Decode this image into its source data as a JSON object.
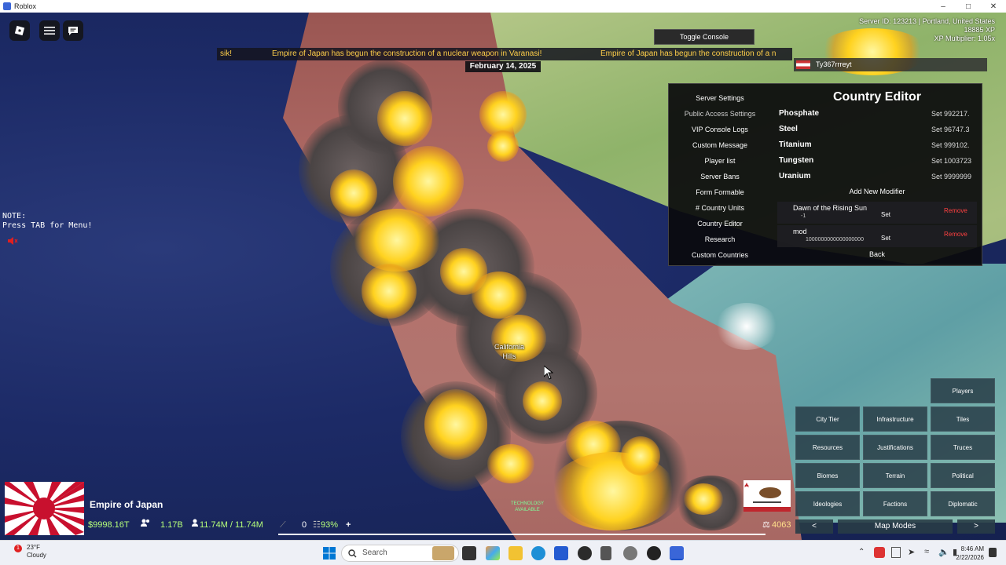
{
  "window": {
    "title": "Roblox"
  },
  "hud": {
    "note_line1": "NOTE:",
    "note_line2": "Press TAB for Menu!",
    "toggle_console": "Toggle Console",
    "date": "February 14, 2025",
    "ticker": [
      "sik!",
      "Empire of Japan has begun the construction of a nuclear weapon in Varanasi!",
      "Empire of Japan has begun the construction of a n"
    ],
    "server_info": [
      "Server ID: 123213 | Portland, United States",
      "18885 XP",
      "XP Multiplier: 1.05x"
    ],
    "player_name": "Ty367rrreyt"
  },
  "map": {
    "label_line1": "California",
    "label_line2": "Hills",
    "tech_badge_line1": "TECHNOLOGY",
    "tech_badge_line2": "AVAILABLE"
  },
  "panel": {
    "title": "Country Editor",
    "menu": [
      "Server Settings",
      "Public Access Settings",
      "VIP Console Logs",
      "Custom Message",
      "Player list",
      "Server Bans",
      "Form Formable",
      "# Country Units",
      "Country Editor",
      "Research",
      "Custom Countries"
    ],
    "resources": [
      {
        "name": "Phosphate",
        "set": "Set 992217."
      },
      {
        "name": "Steel",
        "set": "Set 96747.3"
      },
      {
        "name": "Titanium",
        "set": "Set 999102."
      },
      {
        "name": "Tungsten",
        "set": "Set 1003723"
      },
      {
        "name": "Uranium",
        "set": "Set 9999999"
      }
    ],
    "add_modifier": "Add New Modifier",
    "modifiers": [
      {
        "name": "Dawn of the Rising Sun",
        "value": "-1",
        "set": "Set",
        "remove": "Remove"
      },
      {
        "name": "mod",
        "value": "1000000000000000000",
        "set": "Set",
        "remove": "Remove"
      }
    ],
    "back": "Back"
  },
  "map_modes": {
    "players": "Players",
    "grid": [
      "City Tier",
      "Infrastructure",
      "Tiles",
      "Resources",
      "Justifications",
      "Truces",
      "Biomes",
      "Terrain",
      "Political",
      "Ideologies",
      "Factions",
      "Diplomatic"
    ],
    "prev": "<",
    "next": ">",
    "label": "Map Modes"
  },
  "country": {
    "name": "Empire of Japan",
    "money": "$9998.16T",
    "population": "1.17B",
    "manpower": "11.74M / 11.74M",
    "stat_zero": "0",
    "stability": "93%",
    "plus": "+",
    "right_value": "4063"
  },
  "taskbar": {
    "temp": "23°F",
    "weather": "Cloudy",
    "search": "Search",
    "time": "8:46 AM",
    "date": "2/22/2026",
    "notif_count": "1"
  },
  "colors": {
    "ticker_text": "#ffcf4a",
    "stat_green": "#b6ff7a",
    "remove_red": "#ff4040"
  }
}
